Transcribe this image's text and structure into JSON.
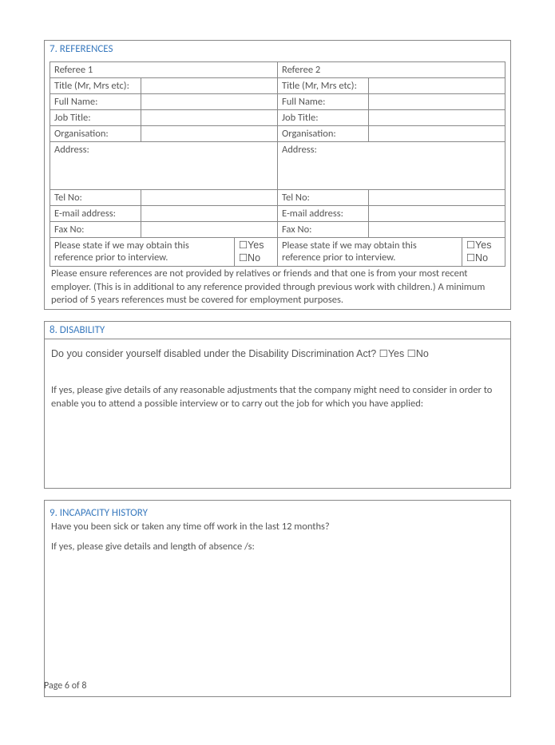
{
  "sections": {
    "references": {
      "heading": "7. REFERENCES",
      "ref1": {
        "header": "Referee 1",
        "title_label": "Title (Mr, Mrs etc):",
        "fullname_label": "Full Name:",
        "jobtitle_label": "Job Title:",
        "organisation_label": "Organisation:",
        "address_label": "Address:",
        "tel_label": "Tel No:",
        "email_label": "E-mail address:",
        "fax_label": "Fax No:",
        "obtain_text": "Please state if we may obtain this reference prior to interview.",
        "yes": "☐Yes",
        "no": "☐No"
      },
      "ref2": {
        "header": "Referee 2",
        "title_label": "Title (Mr, Mrs etc):",
        "fullname_label": "Full Name:",
        "jobtitle_label": "Job Title:",
        "organisation_label": "Organisation:",
        "address_label": "Address:",
        "tel_label": "Tel No:",
        "email_label": "E-mail address:",
        "fax_label": "Fax No:",
        "obtain_text": "Please state if we may obtain this reference prior to interview.",
        "yes": "☐Yes",
        "no": "☐No"
      },
      "note": "Please ensure references are not provided by relatives or friends and that one is from your most recent employer. (This is in additional to any reference provided through previous work with children.) A minimum period of 5 years references must be covered for employment purposes."
    },
    "disability": {
      "heading": "8. DISABILITY",
      "question": "Do you consider yourself disabled under the Disability Discrimination Act?   ☐Yes   ☐No",
      "details_prompt": "If yes, please give details of any reasonable adjustments that the company might need to consider in order to enable you to attend a possible interview or to carry out the job for which you have applied:"
    },
    "incapacity": {
      "heading": "9. INCAPACITY HISTORY",
      "question": "Have you been sick or taken any time off work in the last 12 months?",
      "details_prompt": "If yes, please give details and length of absence /s:"
    }
  },
  "footer": "Page 6 of 8"
}
